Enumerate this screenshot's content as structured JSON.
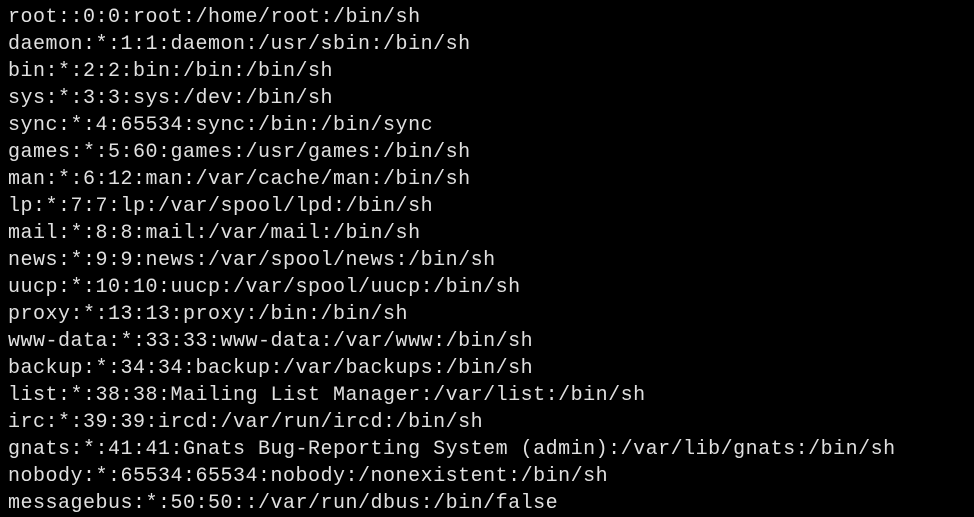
{
  "lines": [
    "root::0:0:root:/home/root:/bin/sh",
    "daemon:*:1:1:daemon:/usr/sbin:/bin/sh",
    "bin:*:2:2:bin:/bin:/bin/sh",
    "sys:*:3:3:sys:/dev:/bin/sh",
    "sync:*:4:65534:sync:/bin:/bin/sync",
    "games:*:5:60:games:/usr/games:/bin/sh",
    "man:*:6:12:man:/var/cache/man:/bin/sh",
    "lp:*:7:7:lp:/var/spool/lpd:/bin/sh",
    "mail:*:8:8:mail:/var/mail:/bin/sh",
    "news:*:9:9:news:/var/spool/news:/bin/sh",
    "uucp:*:10:10:uucp:/var/spool/uucp:/bin/sh",
    "proxy:*:13:13:proxy:/bin:/bin/sh",
    "www-data:*:33:33:www-data:/var/www:/bin/sh",
    "backup:*:34:34:backup:/var/backups:/bin/sh",
    "list:*:38:38:Mailing List Manager:/var/list:/bin/sh",
    "irc:*:39:39:ircd:/var/run/ircd:/bin/sh",
    "gnats:*:41:41:Gnats Bug-Reporting System (admin):/var/lib/gnats:/bin/sh",
    "nobody:*:65534:65534:nobody:/nonexistent:/bin/sh",
    "messagebus:*:50:50::/var/run/dbus:/bin/false"
  ]
}
